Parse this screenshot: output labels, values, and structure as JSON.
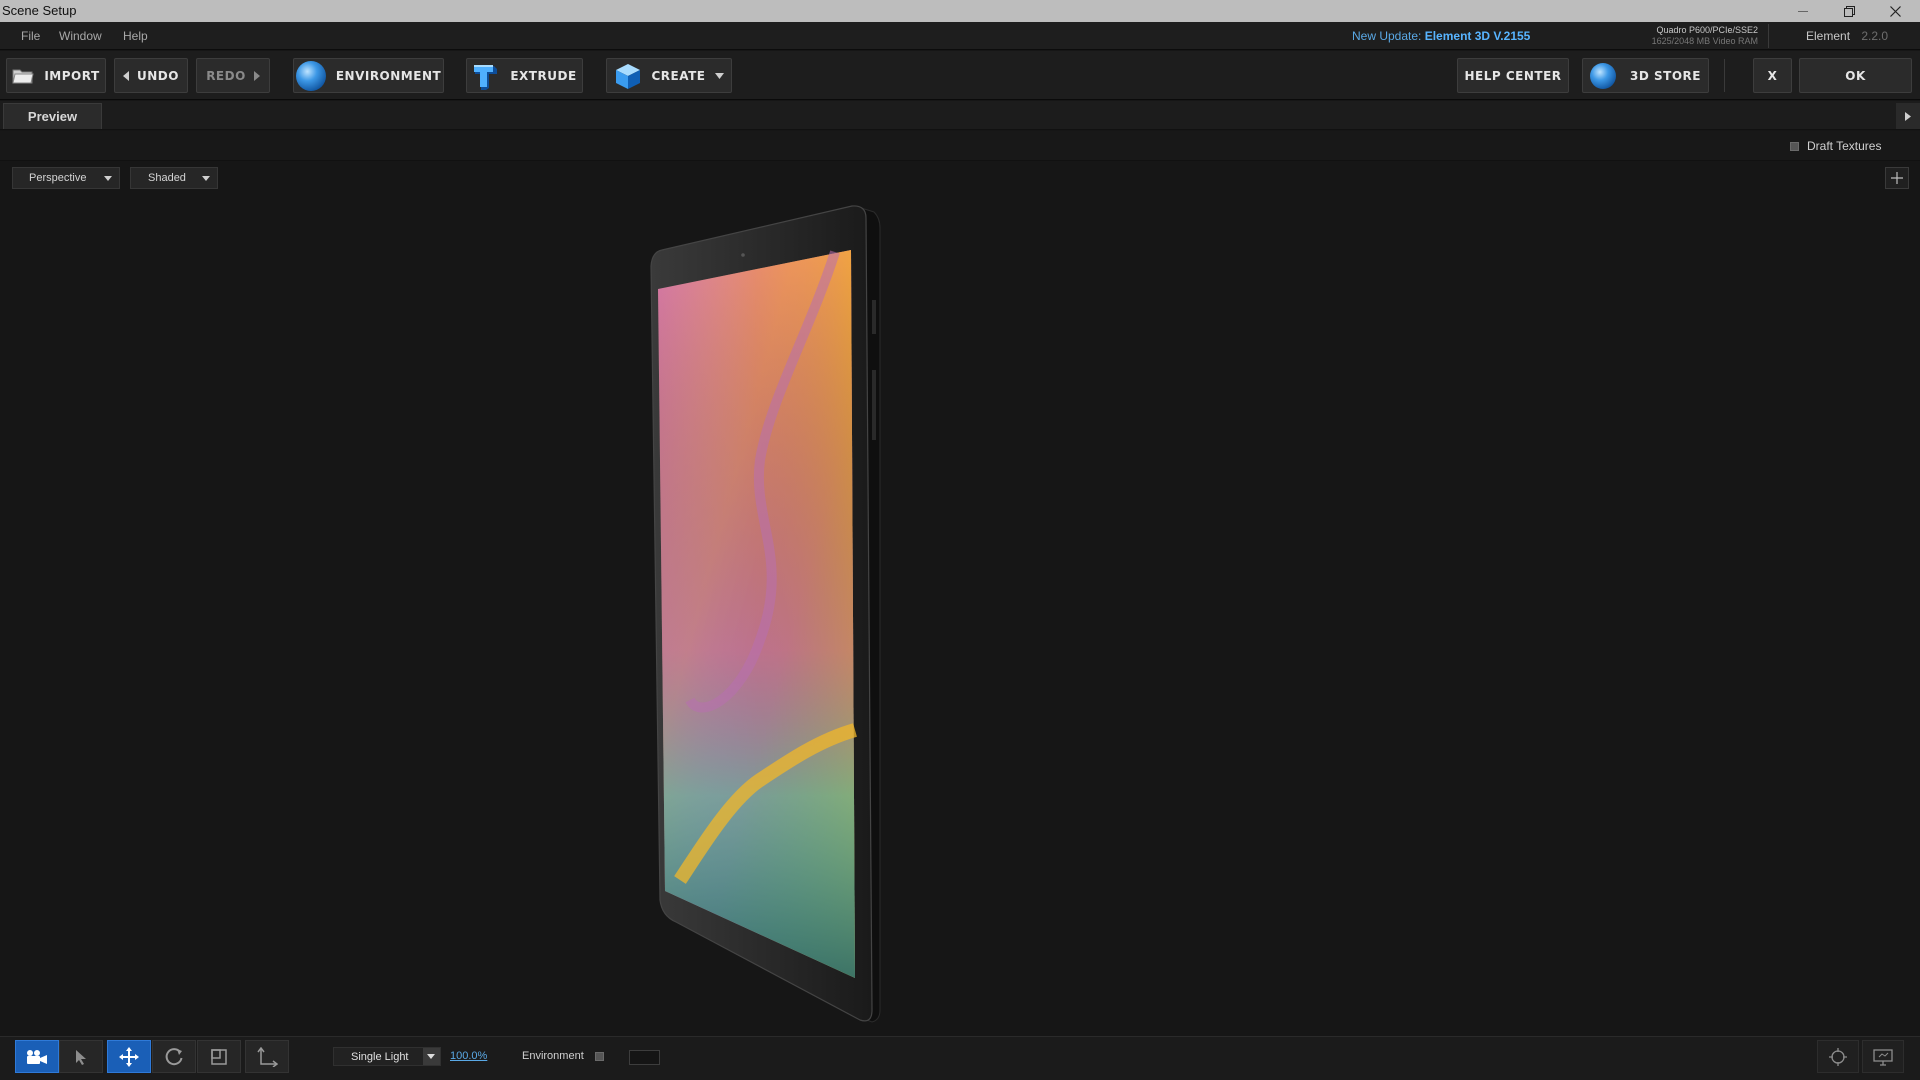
{
  "window": {
    "title": "Scene Setup"
  },
  "menu": [
    "File",
    "Window",
    "Help"
  ],
  "update": {
    "prefix": "New Update:",
    "version": "Element 3D V.2155"
  },
  "gpu": {
    "name": "Quadro P600/PCIe/SSE2",
    "vram": "1625/2048 MB Video RAM"
  },
  "product": {
    "name": "Element",
    "version": "2.2.0"
  },
  "toolbar": {
    "import": "IMPORT",
    "undo": "UNDO",
    "redo": "REDO",
    "environment": "ENVIRONMENT",
    "extrude": "EXTRUDE",
    "create": "CREATE",
    "help_center": "HELP CENTER",
    "store": "3D STORE",
    "close": "X",
    "ok": "OK"
  },
  "tabs": {
    "preview": "Preview"
  },
  "draft_textures": "Draft Textures",
  "viewport": {
    "camera": "Perspective",
    "shading": "Shaded"
  },
  "bottom": {
    "light_mode": "Single Light",
    "light_percent": "100.0%",
    "environment_label": "Environment"
  }
}
